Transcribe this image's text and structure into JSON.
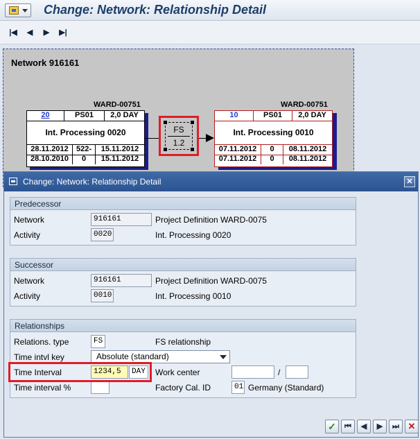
{
  "window": {
    "title": "Change: Network: Relationship Detail"
  },
  "nav_buttons": [
    "first-page-icon",
    "previous-page-icon",
    "next-page-icon",
    "last-page-icon"
  ],
  "network_graphic": {
    "title": "Network 916161",
    "predecessor_node": {
      "label": "WARD-00751",
      "number": "20",
      "work_center": "PS01",
      "duration": "2,0 DAY",
      "name": "Int. Processing 0020",
      "row1": [
        "28.11.2012",
        "522-",
        "15.11.2012"
      ],
      "row2": [
        "28.10.2010",
        "0",
        "15.11.2012"
      ]
    },
    "successor_node": {
      "label": "WARD-00751",
      "number": "10",
      "work_center": "PS01",
      "duration": "2,0 DAY",
      "name": "Int. Processing 0010",
      "row1": [
        "07.11.2012",
        "0",
        "08.11.2012"
      ],
      "row2": [
        "07.11.2012",
        "0",
        "08.11.2012"
      ]
    },
    "relationship": {
      "type": "FS",
      "value": "1.2"
    }
  },
  "dialog": {
    "title": "Change: Network: Relationship Detail",
    "predecessor": {
      "header": "Predecessor",
      "network_label": "Network",
      "network_value": "916161",
      "network_desc": "Project Definition WARD-0075",
      "activity_label": "Activity",
      "activity_value": "0020",
      "activity_desc": "Int. Processing 0020"
    },
    "successor": {
      "header": "Successor",
      "network_label": "Network",
      "network_value": "916161",
      "network_desc": "Project Definition WARD-0075",
      "activity_label": "Activity",
      "activity_value": "0010",
      "activity_desc": "Int. Processing 0010"
    },
    "relationships": {
      "header": "Relationships",
      "type_label": "Relations. type",
      "type_value": "FS",
      "type_desc": "FS relationship",
      "time_key_label": "Time intvl key",
      "time_key_value": "Absolute (standard)",
      "interval_label": "Time Interval",
      "interval_value": "1234,5",
      "interval_unit": "DAY",
      "work_center_label": "Work center",
      "work_center_value": "",
      "work_center_plant": "",
      "slash": "/",
      "interval_pct_label": "Time interval %",
      "interval_pct_value": "",
      "factory_cal_label": "Factory Cal. ID",
      "factory_cal_value": "01",
      "factory_cal_desc": "Germany (Standard)"
    },
    "buttons": {
      "confirm": "✓",
      "first": "⏮",
      "prev": "◀",
      "next": "▶",
      "last": "⏭",
      "cancel": "✕"
    }
  }
}
